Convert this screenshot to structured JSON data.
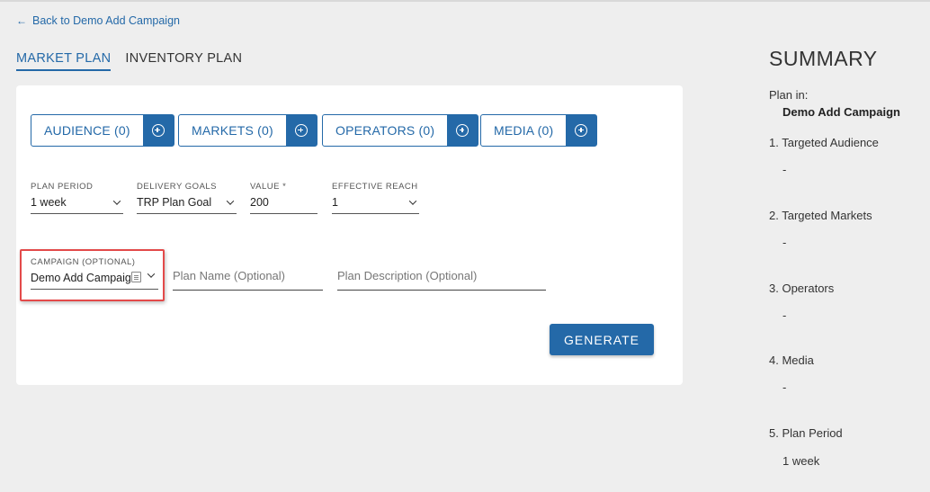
{
  "nav": {
    "back_label": "Back to Demo Add Campaign",
    "back_arrow": "←"
  },
  "tabs": [
    {
      "label": "MARKET PLAN",
      "active": true
    },
    {
      "label": "INVENTORY PLAN",
      "active": false
    }
  ],
  "pills": [
    {
      "label": "AUDIENCE (0)"
    },
    {
      "label": "MARKETS (0)"
    },
    {
      "label": "OPERATORS (0)"
    },
    {
      "label": "MEDIA (0)"
    }
  ],
  "fields": {
    "plan_period": {
      "label": "PLAN PERIOD",
      "value": "1 week"
    },
    "delivery_goals": {
      "label": "DELIVERY GOALS",
      "value": "TRP Plan Goal"
    },
    "value": {
      "label": "VALUE *",
      "value": "200"
    },
    "effective_reach": {
      "label": "EFFECTIVE REACH",
      "value": "1"
    },
    "campaign": {
      "label": "CAMPAIGN (OPTIONAL)",
      "value": "Demo Add Campaign"
    },
    "plan_name": {
      "placeholder": "Plan Name (Optional)"
    },
    "plan_description": {
      "placeholder": "Plan Description (Optional)"
    }
  },
  "generate_label": "GENERATE",
  "summary": {
    "title": "SUMMARY",
    "plan_in_label": "Plan in:",
    "plan_in_value": "Demo Add Campaign",
    "sections": [
      {
        "label": "1. Targeted Audience",
        "value": "-"
      },
      {
        "label": "2. Targeted Markets",
        "value": "-"
      },
      {
        "label": "3. Operators",
        "value": "-"
      },
      {
        "label": "4. Media",
        "value": "-"
      },
      {
        "label": "5. Plan Period",
        "value": "1 week"
      }
    ]
  },
  "colors": {
    "accent": "#2469a8",
    "highlight": "#e34a4a",
    "background": "#eeeeee"
  },
  "icons": {
    "add": "plus-circle-icon",
    "dropdown": "chevron-down-icon",
    "back": "arrow-left-icon"
  }
}
